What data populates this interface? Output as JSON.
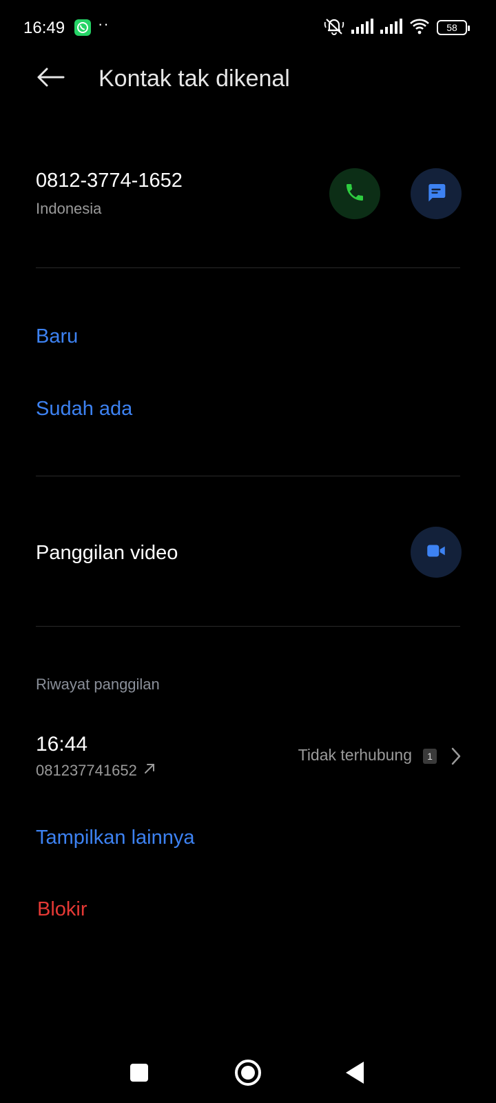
{
  "status_bar": {
    "time": "16:49",
    "dots": "··",
    "battery": "58",
    "icons": [
      "whatsapp-icon",
      "mute-icon",
      "signal-icon",
      "signal-icon",
      "wifi-icon",
      "battery-icon"
    ]
  },
  "header": {
    "title": "Kontak tak dikenal",
    "back_icon": "arrow-left-icon"
  },
  "contact": {
    "number": "0812-3774-1652",
    "country": "Indonesia",
    "call_icon": "phone-icon",
    "message_icon": "message-icon",
    "colors": {
      "call_bg": "#0c2e16",
      "call_fg": "#2ecc40",
      "msg_bg": "#13213a",
      "msg_fg": "#3d82f2"
    }
  },
  "add_contact": {
    "new_label": "Baru",
    "existing_label": "Sudah ada"
  },
  "video_call": {
    "label": "Panggilan video",
    "icon": "video-camera-icon"
  },
  "call_history": {
    "section_label": "Riwayat panggilan",
    "entries": [
      {
        "time": "16:44",
        "number": "081237741652",
        "status": "Tidak terhubung",
        "count": "1",
        "direction_icon": "outgoing-arrow-icon"
      }
    ],
    "show_more_label": "Tampilkan lainnya"
  },
  "block_label": "Blokir",
  "colors": {
    "background": "#000000",
    "link": "#3d82f2",
    "danger": "#e53935",
    "secondary_text": "#9a9a9a"
  }
}
